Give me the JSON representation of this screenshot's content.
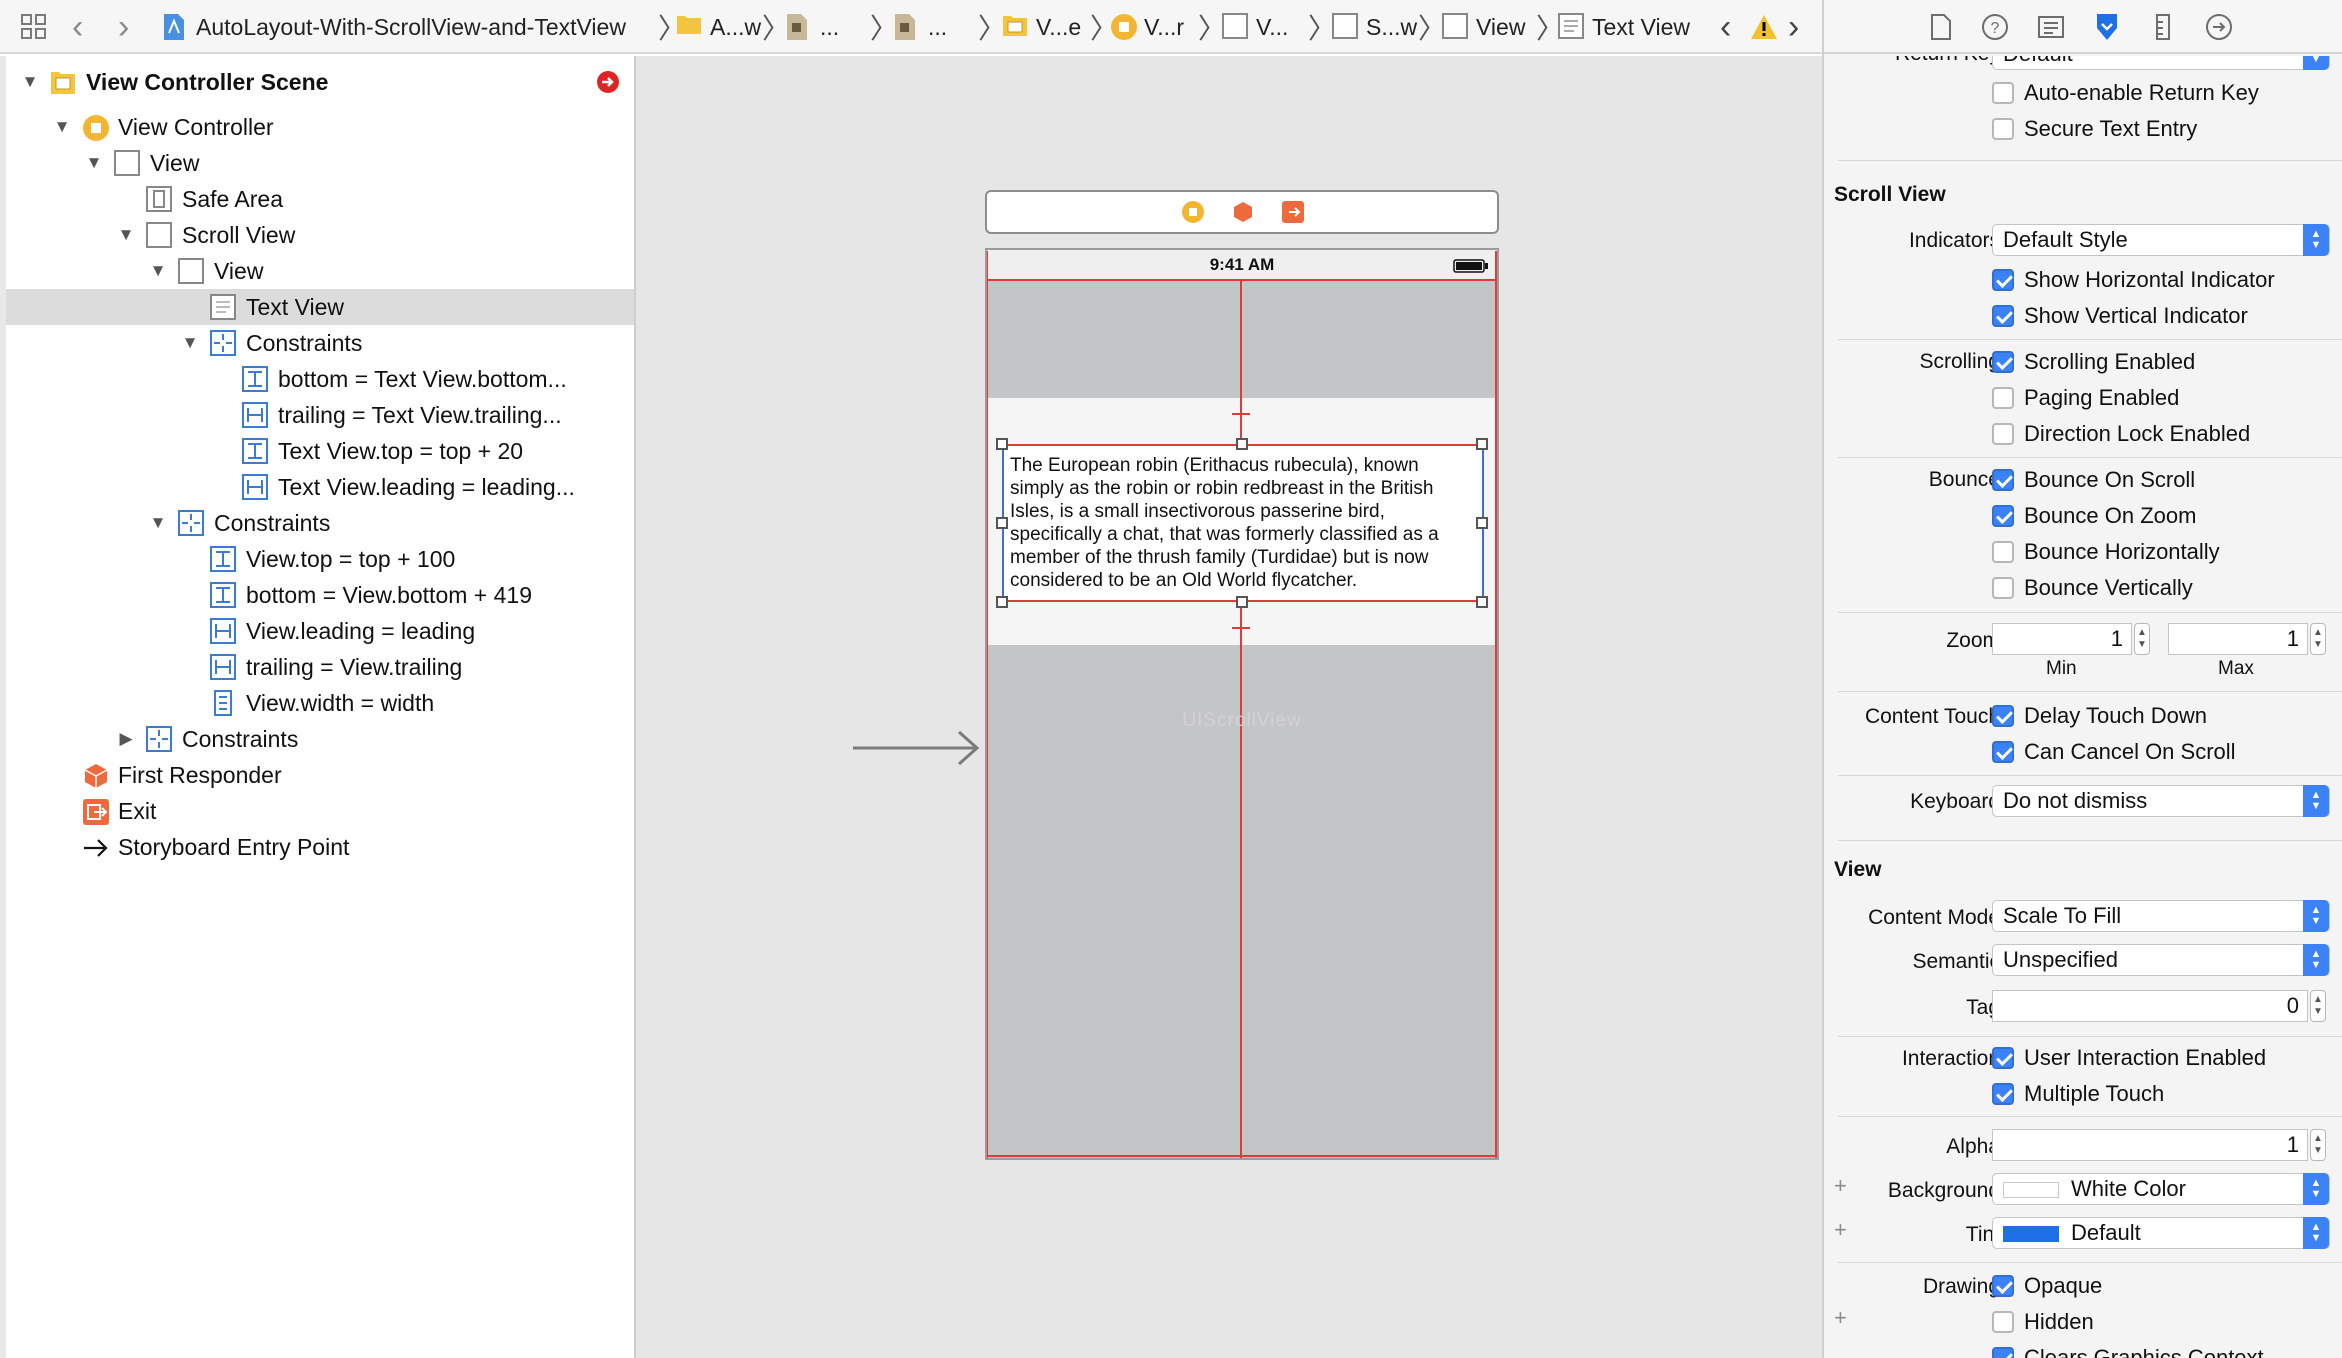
{
  "jumpbar": {
    "project": "AutoLayout-With-ScrollView-and-TextView",
    "crumbs": [
      "A...w",
      "...",
      "...",
      "V...e",
      "V...r",
      "V...",
      "S...w",
      "View",
      "Text View"
    ],
    "warning": "⚠"
  },
  "outline": {
    "scene_title": "View Controller Scene",
    "items": [
      {
        "label": "View Controller"
      },
      {
        "label": "View"
      },
      {
        "label": "Safe Area"
      },
      {
        "label": "Scroll View"
      },
      {
        "label": "View"
      },
      {
        "label": "Text View"
      },
      {
        "label": "Constraints"
      },
      {
        "label": "bottom = Text View.bottom..."
      },
      {
        "label": "trailing = Text View.trailing..."
      },
      {
        "label": "Text View.top = top + 20"
      },
      {
        "label": "Text View.leading = leading..."
      },
      {
        "label": "Constraints"
      },
      {
        "label": "View.top = top + 100"
      },
      {
        "label": "bottom = View.bottom + 419"
      },
      {
        "label": "View.leading = leading"
      },
      {
        "label": "trailing = View.trailing"
      },
      {
        "label": "View.width = width"
      },
      {
        "label": "Constraints"
      },
      {
        "label": "First Responder"
      },
      {
        "label": "Exit"
      },
      {
        "label": "Storyboard Entry Point"
      }
    ]
  },
  "canvas": {
    "status_time": "9:41 AM",
    "text_content": "The European robin (Erithacus rubecula), known simply as the robin or robin redbreast in the British Isles, is a small insectivorous passerine bird, specifically a chat, that was formerly classified as a member of the thrush family (Turdidae) but is now considered to be an Old World flycatcher.",
    "watermark": "UIScrollView"
  },
  "inspector": {
    "cut_label": "Return Key",
    "cut_value": "Default",
    "auto_enable": "Auto-enable Return Key",
    "secure_text": "Secure Text Entry",
    "scroll_title": "Scroll View",
    "indicators_label": "Indicators",
    "indicators_value": "Default Style",
    "show_h": "Show Horizontal Indicator",
    "show_v": "Show Vertical Indicator",
    "scrolling_label": "Scrolling",
    "scrolling_enabled": "Scrolling Enabled",
    "paging_enabled": "Paging Enabled",
    "direction_lock": "Direction Lock Enabled",
    "bounce_label": "Bounce",
    "bounce_on_scroll": "Bounce On Scroll",
    "bounce_on_zoom": "Bounce On Zoom",
    "bounce_h": "Bounce Horizontally",
    "bounce_v": "Bounce Vertically",
    "zoom_label": "Zoom",
    "zoom_min": "1",
    "zoom_max": "1",
    "min_label": "Min",
    "max_label": "Max",
    "content_touch_label": "Content Touch",
    "delay_touch": "Delay Touch Down",
    "can_cancel": "Can Cancel On Scroll",
    "keyboard_label": "Keyboard",
    "keyboard_value": "Do not dismiss",
    "view_title": "View",
    "content_mode_label": "Content Mode",
    "content_mode_value": "Scale To Fill",
    "semantic_label": "Semantic",
    "semantic_value": "Unspecified",
    "tag_label": "Tag",
    "tag_value": "0",
    "interaction_label": "Interaction",
    "user_interaction": "User Interaction Enabled",
    "multiple_touch": "Multiple Touch",
    "alpha_label": "Alpha",
    "alpha_value": "1",
    "background_label": "Background",
    "background_value": "White Color",
    "tint_label": "Tint",
    "tint_value": "Default",
    "drawing_label": "Drawing",
    "opaque": "Opaque",
    "hidden": "Hidden",
    "clears_graphics": "Clears Graphics Context",
    "plus": "+"
  },
  "colors": {
    "accent": "#3b82f6",
    "constraint_red": "#e23a3a",
    "tint_blue": "#1f6fe8"
  }
}
